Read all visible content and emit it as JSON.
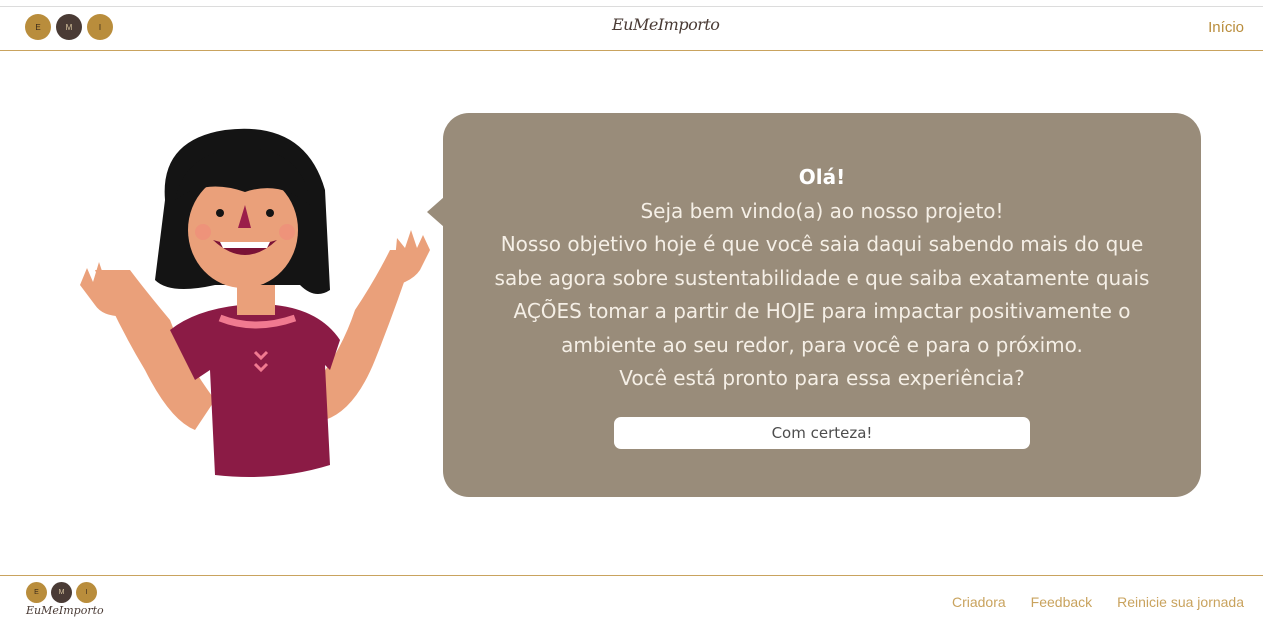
{
  "header": {
    "logo_text": "EuMeImporto",
    "nav_home": "Início",
    "dots": [
      "E",
      "M",
      "I"
    ]
  },
  "bubble": {
    "greeting": "Olá!",
    "lines": [
      "Seja bem vindo(a) ao nosso projeto!",
      "Nosso objetivo hoje é que você saia daqui sabendo mais do que",
      "sabe agora sobre sustentabilidade e que saiba exatamente quais",
      "AÇÕES tomar a partir de HOJE para impactar positivamente o",
      "ambiente ao seu redor, para você e para o próximo.",
      "Você está pronto para essa experiência?"
    ],
    "button_label": "Com certeza!"
  },
  "footer": {
    "logo_text": "EuMeImporto",
    "dots": [
      "E",
      "M",
      "I"
    ],
    "links": [
      "Criadora",
      "Feedback",
      "Reinicie sua jornada"
    ]
  },
  "colors": {
    "gold": "#b98d3c",
    "dark": "#4a3b35",
    "bubble": "#998c7a",
    "shirt": "#8b1b45"
  }
}
